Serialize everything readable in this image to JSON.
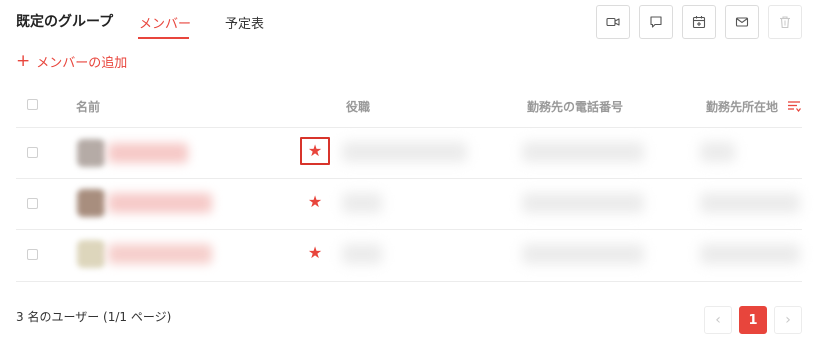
{
  "header": {
    "group_title": "既定のグループ",
    "tabs": [
      {
        "label": "メンバー",
        "active": true
      },
      {
        "label": "予定表",
        "active": false
      }
    ],
    "toolbar_icons": [
      "video-call-icon",
      "chat-icon",
      "calendar-icon",
      "mail-icon",
      "trash-icon"
    ]
  },
  "actions": {
    "add_member_icon": "+",
    "add_member_label": "メンバーの追加"
  },
  "table": {
    "columns": {
      "name": "名前",
      "role": "役職",
      "work_phone": "勤務先の電話番号",
      "work_location": "勤務先所在地"
    },
    "sort_icon": "filter-sort-icon",
    "rows": [
      {
        "favorite_icon": "★",
        "favorite_highlighted": true
      },
      {
        "favorite_icon": "★",
        "favorite_highlighted": false
      },
      {
        "favorite_icon": "★",
        "favorite_highlighted": false
      }
    ]
  },
  "footer": {
    "summary": "3 名のユーザー (1/1 ページ)",
    "pagination": {
      "prev": "‹",
      "current": "1",
      "next": "›"
    }
  },
  "colors": {
    "accent": "#e8453c",
    "header_text": "#999999",
    "border": "#ececec"
  }
}
